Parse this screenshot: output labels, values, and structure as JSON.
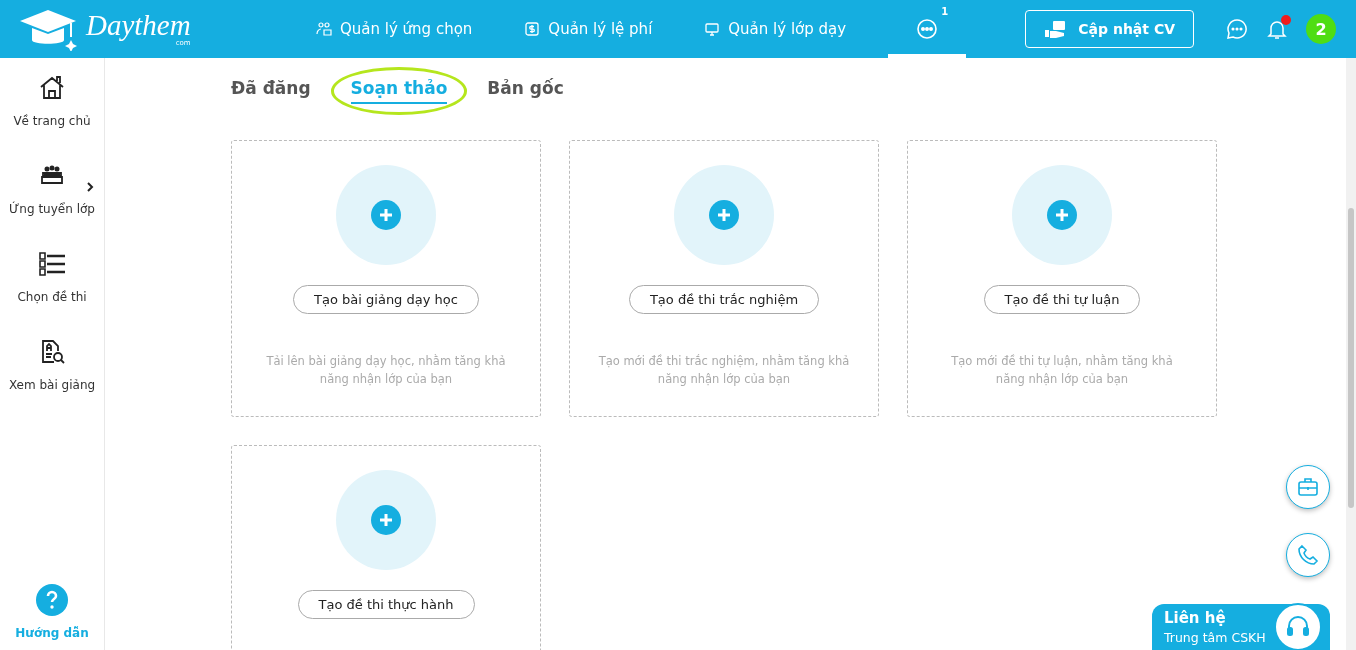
{
  "header": {
    "logo": {
      "name": "Daythem",
      "suffix": "com"
    },
    "nav": [
      {
        "kind": "people",
        "label": "Quản lý ứng chọn",
        "selected": false
      },
      {
        "kind": "dollar",
        "label": "Quản lý lệ phí",
        "selected": false
      },
      {
        "kind": "monitor",
        "label": "Quản lý lớp dạy",
        "selected": false
      },
      {
        "kind": "more",
        "badge": "1",
        "selected": true
      }
    ],
    "cv_button": "Cập nhật CV",
    "notification_dot": true,
    "avatar": "2"
  },
  "sidebar": {
    "items": [
      {
        "kind": "home",
        "label": "Về trang chủ",
        "expandable": false
      },
      {
        "kind": "group",
        "label": "Ứng tuyển lớp",
        "expandable": true
      },
      {
        "kind": "abc",
        "label": "Chọn đề thi",
        "expandable": false
      },
      {
        "kind": "doc",
        "label": "Xem bài giảng",
        "expandable": false
      }
    ],
    "help": "Hướng dẫn"
  },
  "tabs": [
    {
      "label": "Đã đăng",
      "selected": false,
      "highlighted": false
    },
    {
      "label": "Soạn thảo",
      "selected": true,
      "highlighted": true
    },
    {
      "label": "Bản gốc",
      "selected": false,
      "highlighted": false
    }
  ],
  "cards": [
    {
      "button": "Tạo bài giảng dạy học",
      "description": "Tải lên bài giảng dạy học, nhằm tăng khả năng nhận lớp của bạn"
    },
    {
      "button": "Tạo đề thi trắc nghiệm",
      "description": "Tạo mới đề thi trắc nghiệm, nhằm tăng khả năng nhận lớp của bạn"
    },
    {
      "button": "Tạo đề thi tự luận",
      "description": "Tạo mới đề thi tự luận, nhằm tăng khả năng nhận lớp của bạn"
    },
    {
      "button": "Tạo đề thi thực hành"
    }
  ],
  "contact": {
    "title": "Liên hệ",
    "subtitle": "Trung tâm CSKH"
  }
}
